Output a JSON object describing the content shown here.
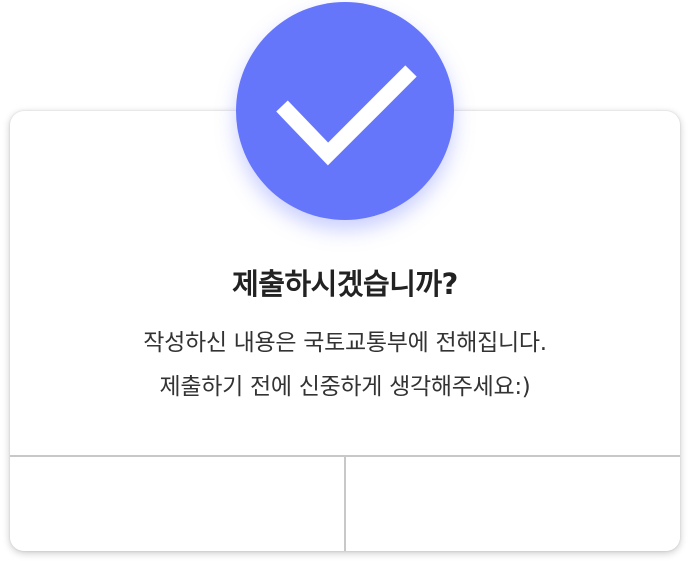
{
  "dialog": {
    "icon": "check-icon",
    "accent_color": "#6676fb",
    "title": "제출하시겠습니까?",
    "message_line1": "작성하신 내용은 국토교통부에 전해집니다.",
    "message_line2": "제출하기 전에 신중하게 생각해주세요:)",
    "buttons": {
      "left_label": "",
      "right_label": ""
    }
  }
}
